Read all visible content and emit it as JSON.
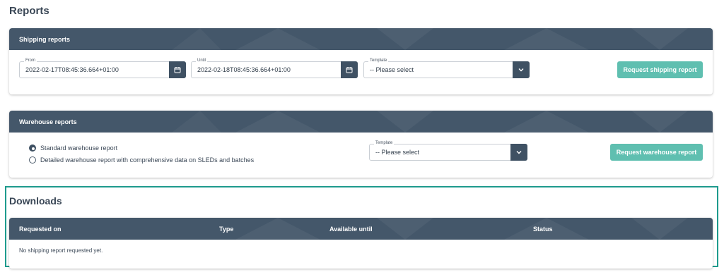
{
  "page": {
    "title": "Reports"
  },
  "shipping": {
    "header": "Shipping reports",
    "from": {
      "label": "From",
      "value": "2022-02-17T08:45:36.664+01:00"
    },
    "until": {
      "label": "Until",
      "value": "2022-02-18T08:45:36.664+01:00"
    },
    "template": {
      "label": "Template",
      "value": "-- Please select"
    },
    "button": "Request shipping report"
  },
  "warehouse": {
    "header": "Warehouse reports",
    "options": [
      {
        "label": "Standard warehouse report",
        "checked": true
      },
      {
        "label": "Detailed warehouse report with comprehensive data on SLEDs and batches",
        "checked": false
      }
    ],
    "template": {
      "label": "Template",
      "value": "-- Please select"
    },
    "button": "Request warehouse report"
  },
  "downloads": {
    "title": "Downloads",
    "columns": [
      "Requested on",
      "Type",
      "Available until",
      "Status"
    ],
    "empty": "No shipping report requested yet."
  },
  "colors": {
    "header": "#44576a",
    "accent": "#5fbfb0",
    "highlight": "#1e9b8d"
  }
}
